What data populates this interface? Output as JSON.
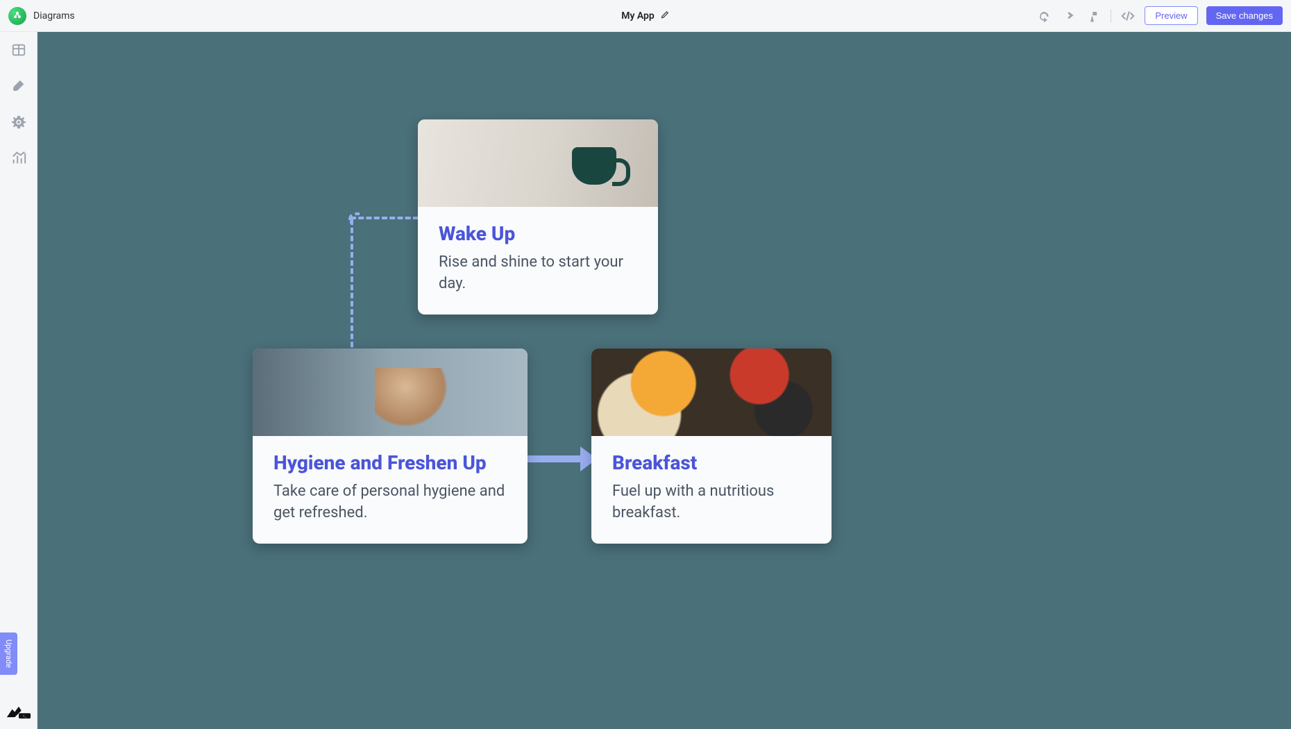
{
  "header": {
    "section_label": "Diagrams",
    "app_name": "My App",
    "preview_label": "Preview",
    "save_label": "Save changes"
  },
  "siderail": {
    "upgrade_label": "Upgrade"
  },
  "cards": [
    {
      "title": "Wake Up",
      "desc": "Rise and shine to start your day."
    },
    {
      "title": "Hygiene and Freshen Up",
      "desc": "Take care of personal hygiene and get refreshed."
    },
    {
      "title": "Breakfast",
      "desc": "Fuel up with a nutritious breakfast."
    }
  ],
  "colors": {
    "canvas_bg": "#4a707a",
    "card_title": "#4b55d8",
    "connector": "#99aef0",
    "primary": "#6366f1"
  }
}
